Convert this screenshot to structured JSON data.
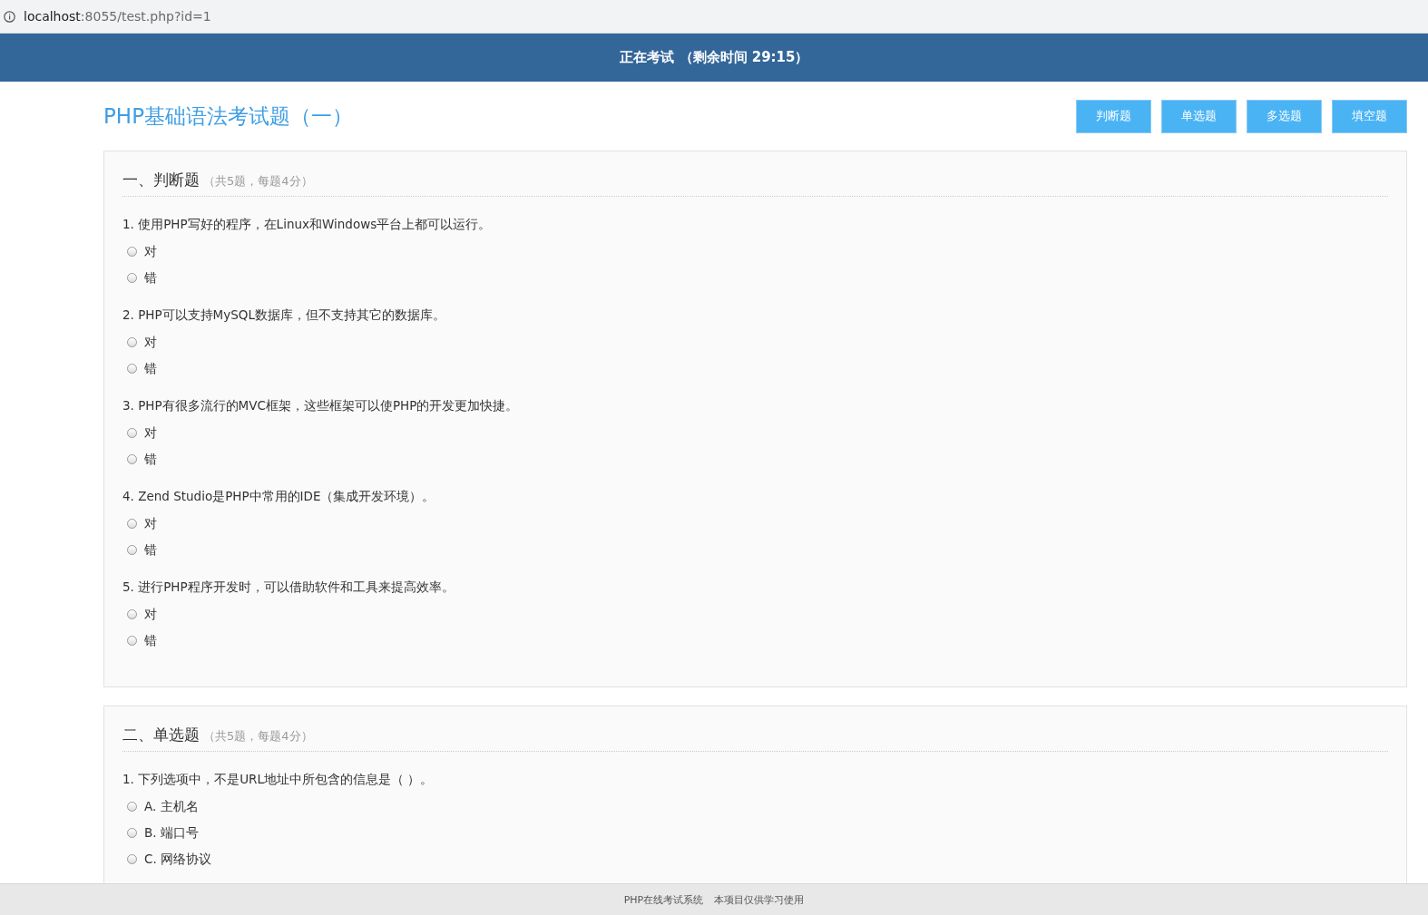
{
  "address_bar": {
    "host": "localhost",
    "path": ":8055/test.php?id=1"
  },
  "header": {
    "status": "正在考试",
    "timer": "（剩余时间 29:15）"
  },
  "title": "PHP基础语法考试题（一）",
  "nav_buttons": [
    "判断题",
    "单选题",
    "多选题",
    "填空题"
  ],
  "sections": [
    {
      "heading": "一、判断题",
      "note": "（共5题，每题4分）",
      "questions": [
        {
          "text": "1. 使用PHP写好的程序，在Linux和Windows平台上都可以运行。",
          "options": [
            {
              "label": "对",
              "selected": false
            },
            {
              "label": "错",
              "selected": false
            }
          ]
        },
        {
          "text": "2. PHP可以支持MySQL数据库，但不支持其它的数据库。",
          "options": [
            {
              "label": "对",
              "selected": false
            },
            {
              "label": "错",
              "selected": false
            }
          ]
        },
        {
          "text": "3. PHP有很多流行的MVC框架，这些框架可以使PHP的开发更加快捷。",
          "options": [
            {
              "label": "对",
              "selected": false
            },
            {
              "label": "错",
              "selected": false
            }
          ]
        },
        {
          "text": "4. Zend Studio是PHP中常用的IDE（集成开发环境）。",
          "options": [
            {
              "label": "对",
              "selected": false
            },
            {
              "label": "错",
              "selected": false
            }
          ]
        },
        {
          "text": "5. 进行PHP程序开发时，可以借助软件和工具来提高效率。",
          "options": [
            {
              "label": "对",
              "selected": false
            },
            {
              "label": "错",
              "selected": false
            }
          ]
        }
      ]
    },
    {
      "heading": "二、单选题",
      "note": "（共5题，每题4分）",
      "questions": [
        {
          "text": "1. 下列选项中，不是URL地址中所包含的信息是（ ）。",
          "options": [
            {
              "label": "A. 主机名",
              "selected": false
            },
            {
              "label": "B. 端口号",
              "selected": false
            },
            {
              "label": "C. 网络协议",
              "selected": false
            }
          ]
        }
      ]
    }
  ],
  "footer": [
    "PHP在线考试系统",
    "本项目仅供学习使用"
  ]
}
